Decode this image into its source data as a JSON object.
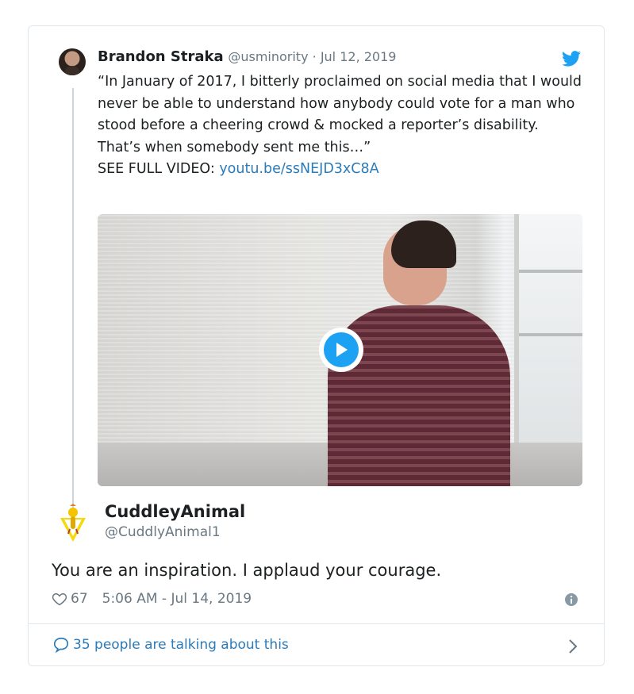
{
  "quoted_tweet": {
    "author_name": "Brandon Straka",
    "author_handle": "@usminority",
    "separator": " · ",
    "date": "Jul 12, 2019",
    "text_lines": [
      "“In January of 2017, I bitterly proclaimed on social media that I would never be able to understand how anybody could vote for a man who stood before a cheering crowd & mocked a reporter’s disability.",
      "That’s when somebody sent me this…”"
    ],
    "video_prefix": "SEE FULL VIDEO: ",
    "video_link": "youtu.be/ssNEJD3xC8A"
  },
  "reply": {
    "author_name": "CuddleyAnimal",
    "author_handle": "@CuddlyAnimal1",
    "text": "You are an inspiration. I applaud your courage.",
    "likes": "67",
    "timestamp": "5:06 AM - Jul 14, 2019"
  },
  "conversation_link": "35 people are talking about this",
  "colors": {
    "twitter_blue": "#1da1f2",
    "link_blue": "#2b7bb9",
    "meta_gray": "#697882",
    "border": "#e1e8ed"
  },
  "icons": [
    "twitter-bird-icon",
    "play-icon",
    "heart-icon",
    "info-icon",
    "speech-bubble-icon",
    "chevron-right-icon"
  ]
}
